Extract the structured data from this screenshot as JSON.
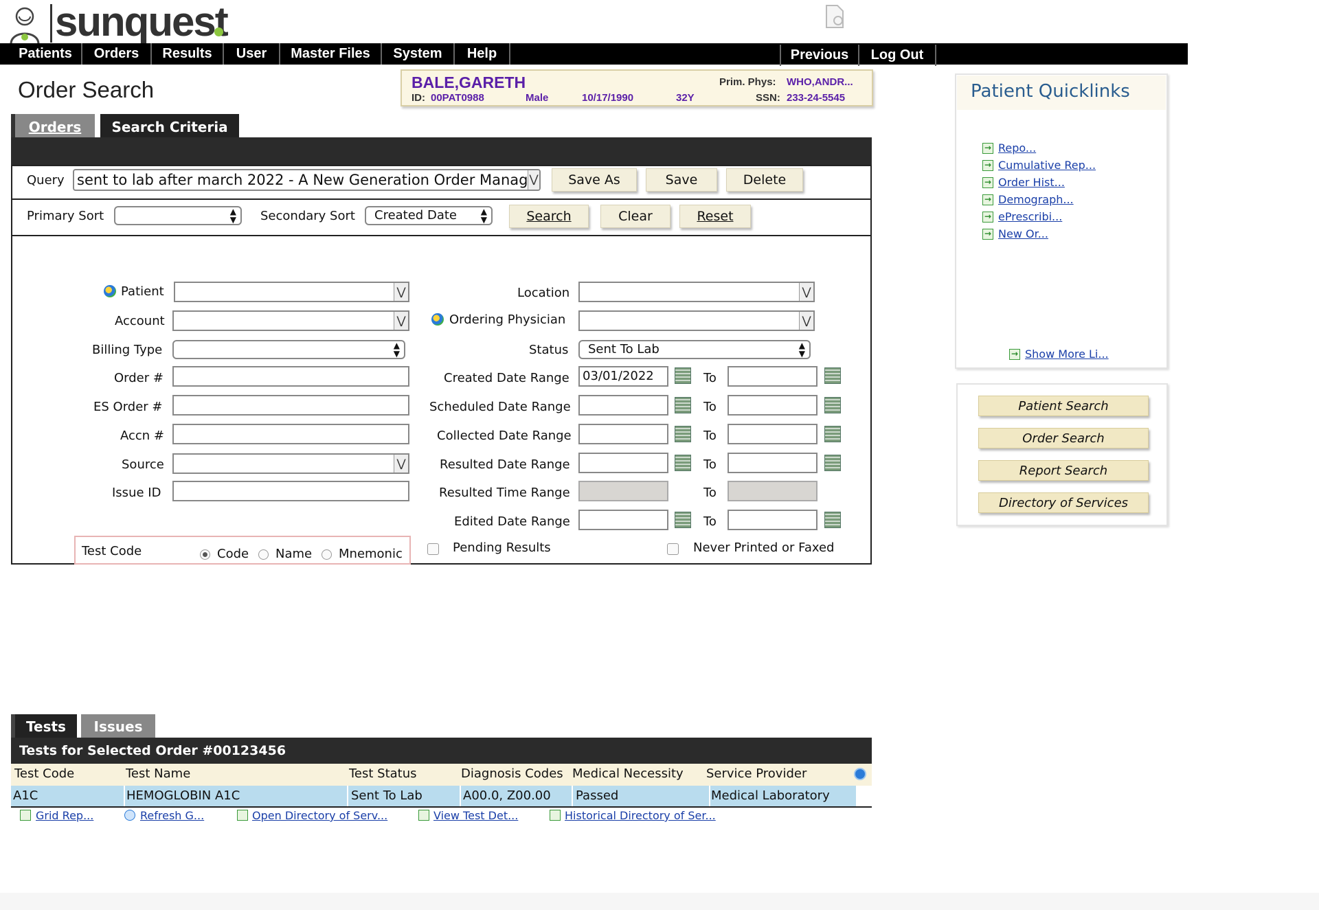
{
  "brand": {
    "logo_text": "sunquest"
  },
  "nav": {
    "items": [
      "Patients",
      "Orders",
      "Results",
      "User",
      "Master Files",
      "System",
      "Help"
    ],
    "right_items": [
      "Previous",
      "Log Out"
    ]
  },
  "page": {
    "title": "Order Search"
  },
  "patient": {
    "name": "BALE,GARETH",
    "id_label": "ID:",
    "id": "00PAT0988",
    "sex": "Male",
    "dob": "10/17/1990",
    "age": "32Y",
    "prim_phys_label": "Prim. Phys:",
    "prim_phys": "WHO,ANDR...",
    "ssn_label": "SSN:",
    "ssn": "233-24-5545"
  },
  "tabs": {
    "orders": "Orders",
    "criteria": "Search Criteria"
  },
  "query": {
    "label": "Query",
    "value": "sent to lab after march 2022 - A New Generation Order Manag",
    "save_as": "Save As",
    "save": "Save",
    "delete": "Delete"
  },
  "sort": {
    "primary_label": "Primary Sort",
    "primary_value": "",
    "secondary_label": "Secondary Sort",
    "secondary_value": "Created Date",
    "search": "Search",
    "clear": "Clear",
    "reset": "Reset"
  },
  "form": {
    "patient": "Patient",
    "account": "Account",
    "billing_type": "Billing Type",
    "order_no": "Order #",
    "es_order_no": "ES Order #",
    "accn_no": "Accn #",
    "source": "Source",
    "issue_id": "Issue ID",
    "location": "Location",
    "ordering_physician": "Ordering Physician",
    "status": "Status",
    "status_value": "Sent To Lab",
    "created_range": "Created Date Range",
    "created_from": "03/01/2022",
    "scheduled_range": "Scheduled Date Range",
    "collected_range": "Collected Date Range",
    "resulted_range": "Resulted Date Range",
    "resulted_time_range": "Resulted Time Range",
    "edited_range": "Edited Date Range",
    "to": "To",
    "test_code": "Test Code",
    "radio_code": "Code",
    "radio_name": "Name",
    "radio_mnemonic": "Mnemonic",
    "pending_results": "Pending Results",
    "never_printed": "Never Printed or Faxed"
  },
  "quicklinks": {
    "title": "Patient Quicklinks",
    "links": [
      "Repo...",
      "Cumulative Rep...",
      "Order Hist...",
      "Demograph...",
      "ePrescribi...",
      "New Or..."
    ],
    "show_more": "Show More Li..."
  },
  "side_buttons": [
    "Patient Search",
    "Order Search",
    "Report Search",
    "Directory of Services"
  ],
  "tests": {
    "tab_tests": "Tests",
    "tab_issues": "Issues",
    "header": "Tests for Selected Order #00123456",
    "columns": [
      "Test Code",
      "Test Name",
      "Test Status",
      "Diagnosis Codes",
      "Medical Necessity",
      "Service Provider"
    ],
    "rows": [
      [
        "A1C",
        "HEMOGLOBIN A1C",
        "Sent To Lab",
        "A00.0, Z00.00",
        "Passed",
        "Medical Laboratory"
      ]
    ],
    "footer_links": [
      "Grid Rep...",
      "Refresh G...",
      "Open Directory of Serv...",
      "View Test Det...",
      "Historical Directory of Ser..."
    ]
  }
}
